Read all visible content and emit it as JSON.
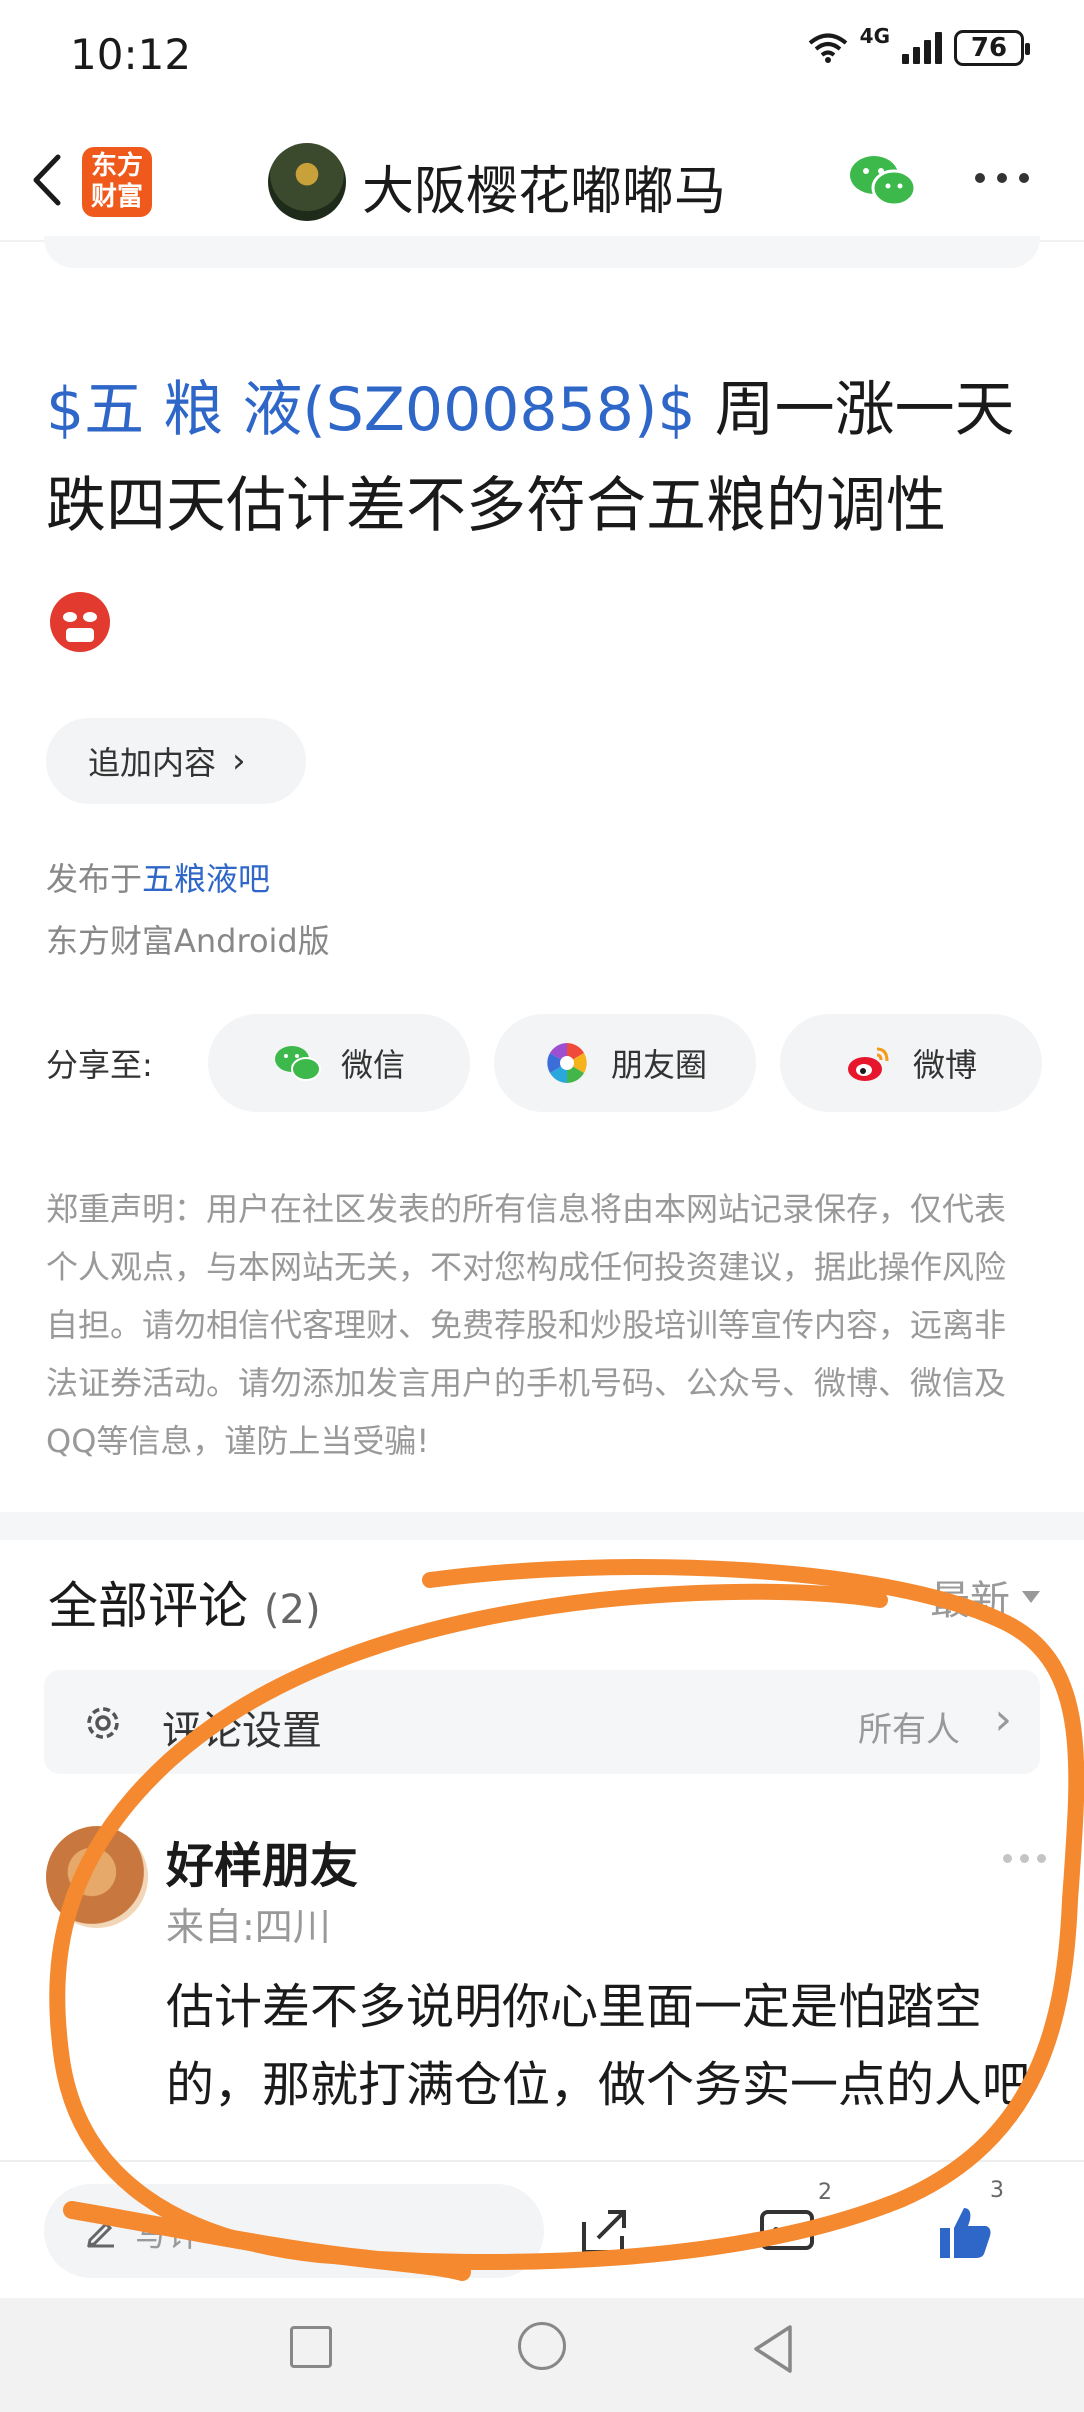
{
  "status_bar": {
    "time": "10:12",
    "network": "4G",
    "battery": "76"
  },
  "header": {
    "logo_text": "东方财富",
    "title": "大阪樱花嘟嘟马"
  },
  "post": {
    "stock_tag": "$五 粮 液(SZ000858)$",
    "title_text": " 周一涨一天跌四天估计差不多符合五粮的调性",
    "append_label": "追加内容",
    "published_prefix": "发布于",
    "bar_name": "五粮液吧",
    "client": "东方财富Android版"
  },
  "share": {
    "label": "分享至:",
    "options": [
      "微信",
      "朋友圈",
      "微博"
    ]
  },
  "disclaimer": "郑重声明：用户在社区发表的所有信息将由本网站记录保存，仅代表个人观点，与本网站无关，不对您构成任何投资建议，据此操作风险自担。请勿相信代客理财、免费荐股和炒股培训等宣传内容，远离非法证券活动。请勿添加发言用户的手机号码、公众号、微博、微信及QQ等信息，谨防上当受骗!",
  "comments": {
    "title": "全部评论",
    "count": "(2)",
    "sort": "最新",
    "settings_label": "评论设置",
    "settings_value": "所有人",
    "items": [
      {
        "name": "好样朋友",
        "location": "来自:四川",
        "text": "估计差不多说明你心里面一定是怕踏空的，那就打满仓位，做个务实一点的人吧"
      }
    ]
  },
  "bottom_bar": {
    "write_placeholder": "写评",
    "comment_count": "2",
    "like_count": "3"
  },
  "colors": {
    "accent": "#2f67c9",
    "logo": "#ef5a1c",
    "annotation": "#f5892f"
  }
}
